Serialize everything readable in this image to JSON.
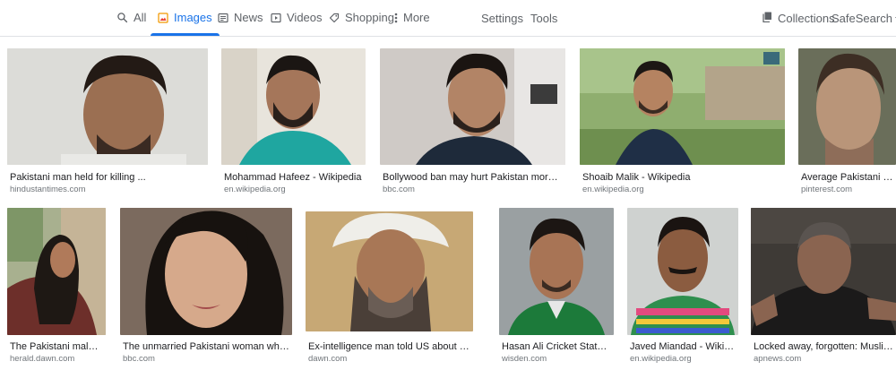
{
  "nav": {
    "tabs": [
      {
        "label": "All",
        "icon": "search-icon"
      },
      {
        "label": "Images",
        "icon": "image-icon",
        "active": true
      },
      {
        "label": "News",
        "icon": "news-icon"
      },
      {
        "label": "Videos",
        "icon": "video-icon"
      },
      {
        "label": "Shopping",
        "icon": "tag-icon"
      },
      {
        "label": "More",
        "icon": "more-vert-icon"
      }
    ],
    "settings_label": "Settings",
    "tools_label": "Tools",
    "collections_label": "Collections",
    "safesearch_label": "SafeSearch"
  },
  "colors": {
    "accent": "#1a73e8",
    "text_secondary": "#5f6368",
    "source": "#70757a"
  },
  "results": [
    {
      "title": "Pakistani man held for killing ...",
      "source": "hindustantimes.com"
    },
    {
      "title": "Mohammad Hafeez - Wikipedia",
      "source": "en.wikipedia.org"
    },
    {
      "title": "Bollywood ban may hurt Pakistan more ...",
      "source": "bbc.com"
    },
    {
      "title": "Shoaib Malik - Wikipedia",
      "source": "en.wikipedia.org"
    },
    {
      "title": "Average Pakistani Man...",
      "source": "pinterest.com"
    },
    {
      "title": "The Pakistani male: Ma...",
      "source": "herald.dawn.com"
    },
    {
      "title": "The unmarried Pakistani woman who wrot...",
      "source": "bbc.com"
    },
    {
      "title": "Ex-intelligence man told US about Osama ...",
      "source": "dawn.com"
    },
    {
      "title": "Hasan Ali Cricket Stats, Ne...",
      "source": "wisden.com"
    },
    {
      "title": "Javed Miandad - Wikipedia",
      "source": "en.wikipedia.org"
    },
    {
      "title": "Locked away, forgotten: Muslim Uig...",
      "source": "apnews.com"
    }
  ]
}
